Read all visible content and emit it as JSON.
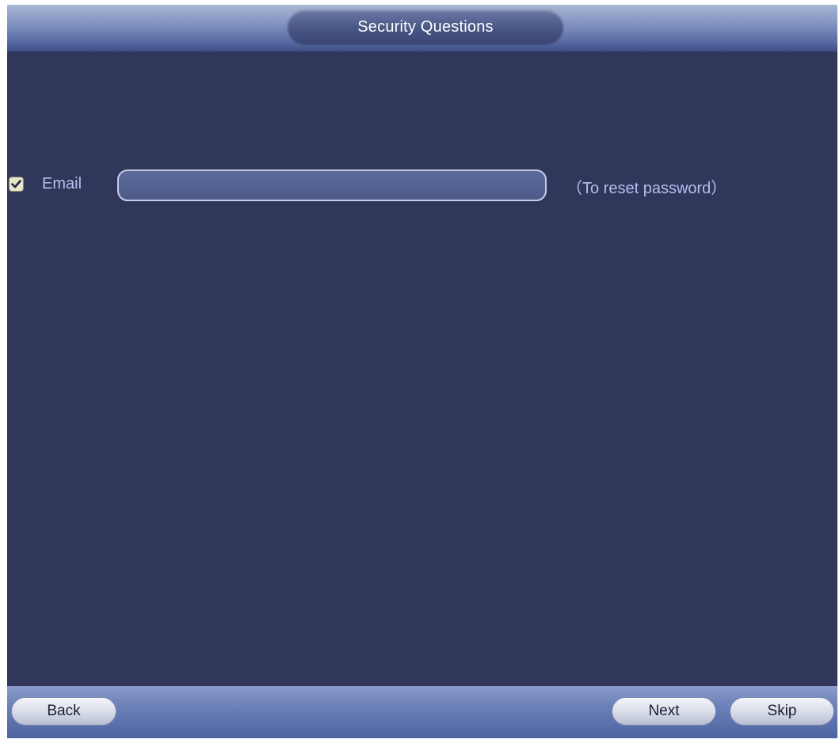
{
  "window": {
    "title": "Security Questions"
  },
  "email": {
    "checked": true,
    "label": "Email",
    "value": "",
    "placeholder": "",
    "hint": "（To reset password）"
  },
  "footer": {
    "back_label": "Back",
    "next_label": "Next",
    "skip_label": "Skip"
  },
  "colors": {
    "background": "#30375a",
    "label_text": "#b3c0ef",
    "checkbox_fill": "#e7e4c9"
  },
  "icons": {
    "checkbox": "check-icon"
  }
}
